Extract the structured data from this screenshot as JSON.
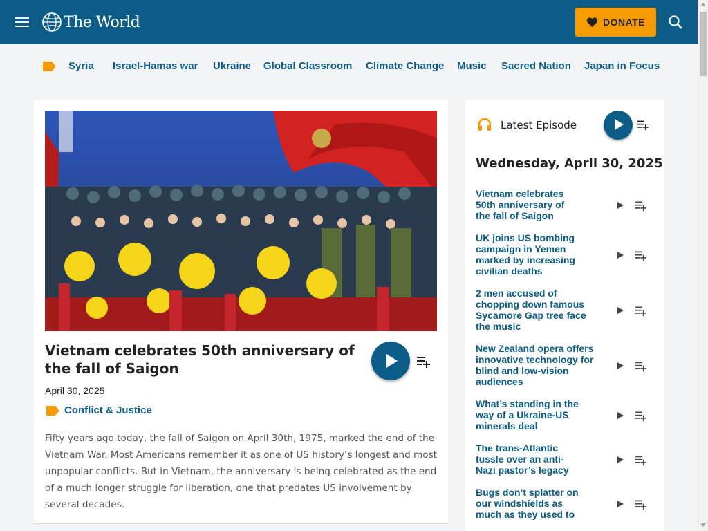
{
  "header": {
    "logo_text": "The World",
    "donate_label": "DONATE"
  },
  "topics": [
    "Syria",
    "Israel-Hamas war",
    "Ukraine",
    "Global Classroom",
    "Climate Change",
    "Music",
    "Sacred Nation",
    "Japan in Focus"
  ],
  "story": {
    "title": "Vietnam celebrates 50th anniversary of the fall of Saigon",
    "date": "April 30, 2025",
    "category": "Conflict & Justice",
    "body": "Fifty years ago today, the fall of Saigon on April 30th, 1975, marked the end of the Vietnam War. Most Americans remember it as one of US history’s longest and most unpopular conflicts. But in Vietnam, the anniversary is being celebrated as the end of a much longer struggle for liberation, one that predates US involvement by several decades."
  },
  "sidebar": {
    "latest_label": "Latest Episode",
    "date": "Wednesday, April 30, 2025",
    "episodes": [
      "Vietnam celebrates 50th anniversary of the fall of Saigon",
      "UK joins US bombing campaign in Yemen marked by increasing civilian deaths",
      "2 men accused of chopping down famous Sycamore Gap tree face the music",
      "New Zealand opera offers innovative technology for blind and low-vision audiences",
      "What’s standing in the way of a Ukraine-US minerals deal",
      "The trans-Atlantic tussle over an anti-Nazi pastor’s legacy",
      "Bugs don’t splatter on our windshields as much as they used to"
    ]
  },
  "colors": {
    "brand_blue": "#0b5d87",
    "accent_orange": "#f79a00"
  }
}
